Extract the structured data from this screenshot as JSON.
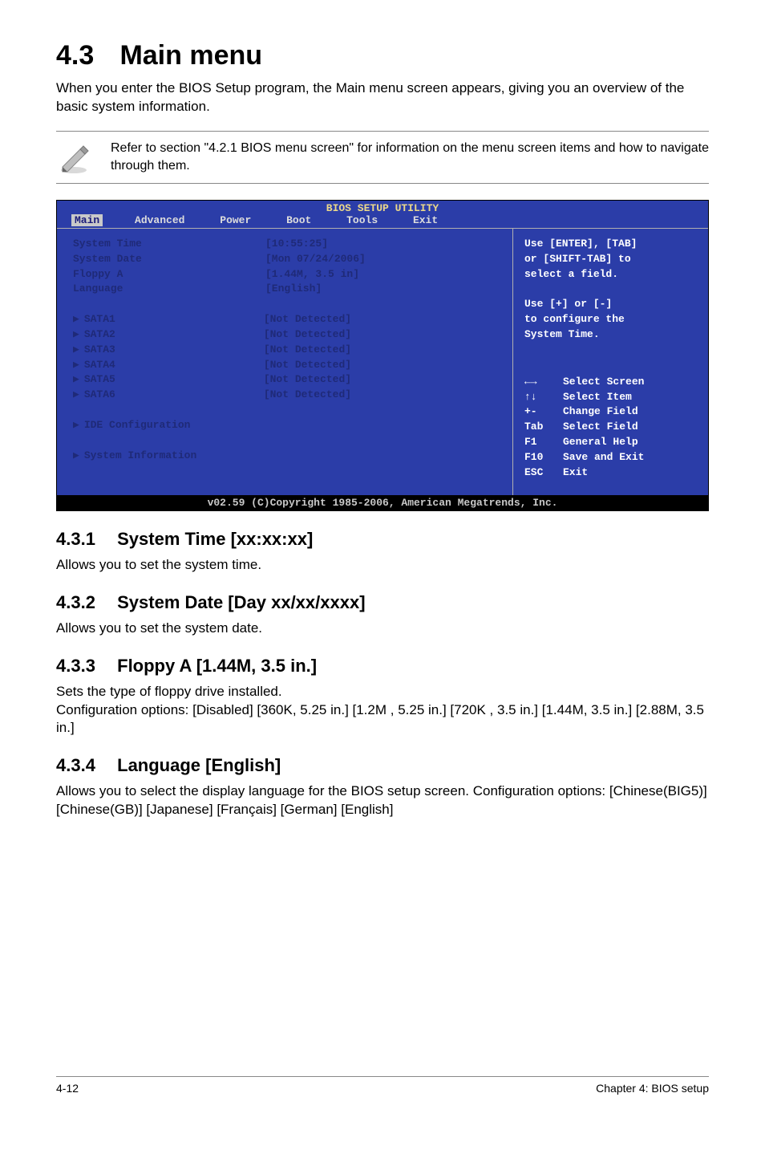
{
  "section": {
    "number": "4.3",
    "title": "Main menu",
    "intro": "When you enter the BIOS Setup program, the Main menu screen appears, giving you an overview of the basic system information."
  },
  "note": "Refer to section \"4.2.1  BIOS menu screen\" for information on the menu screen items and how to navigate through them.",
  "bios": {
    "header": "BIOS SETUP UTILITY",
    "tabs": [
      "Main",
      "Advanced",
      "Power",
      "Boot",
      "Tools",
      "Exit"
    ],
    "active_tab": "Main",
    "fields": [
      {
        "label": "System Time",
        "value": "[10:55:25]"
      },
      {
        "label": "System Date",
        "value": "[Mon 07/24/2006]"
      },
      {
        "label": "Floppy A",
        "value": "[1.44M, 3.5 in]"
      },
      {
        "label": "Language",
        "value": "[English]"
      }
    ],
    "sata": [
      {
        "label": "SATA1",
        "value": "[Not Detected]"
      },
      {
        "label": "SATA2",
        "value": "[Not Detected]"
      },
      {
        "label": "SATA3",
        "value": "[Not Detected]"
      },
      {
        "label": "SATA4",
        "value": "[Not Detected]"
      },
      {
        "label": "SATA5",
        "value": "[Not Detected]"
      },
      {
        "label": "SATA6",
        "value": "[Not Detected]"
      }
    ],
    "submenus": [
      "IDE Configuration",
      "System Information"
    ],
    "help_top": "Use [ENTER], [TAB]\nor [SHIFT-TAB] to\nselect a field.\n\nUse [+] or [-]\nto configure the\nSystem Time.",
    "legend": [
      {
        "key": "←→",
        "desc": "Select Screen"
      },
      {
        "key": "↑↓",
        "desc": "Select Item"
      },
      {
        "key": "+-",
        "desc": "Change Field"
      },
      {
        "key": "Tab",
        "desc": "Select Field"
      },
      {
        "key": "F1",
        "desc": "General Help"
      },
      {
        "key": "F10",
        "desc": "Save and Exit"
      },
      {
        "key": "ESC",
        "desc": "Exit"
      }
    ],
    "footer": "v02.59 (C)Copyright 1985-2006, American Megatrends, Inc."
  },
  "subsections": {
    "s1": {
      "num": "4.3.1",
      "title": "System Time [xx:xx:xx]",
      "body": "Allows you to set the system time."
    },
    "s2": {
      "num": "4.3.2",
      "title": "System Date [Day xx/xx/xxxx]",
      "body": "Allows you to set the system date."
    },
    "s3": {
      "num": "4.3.3",
      "title": "Floppy A [1.44M, 3.5 in.]",
      "body": "Sets the type of floppy drive installed.\nConfiguration options: [Disabled] [360K, 5.25 in.] [1.2M , 5.25 in.] [720K , 3.5 in.] [1.44M, 3.5 in.] [2.88M, 3.5 in.]"
    },
    "s4": {
      "num": "4.3.4",
      "title": "Language [English]",
      "body": "Allows you to select the display language for the BIOS setup screen. Configuration options: [Chinese(BIG5)] [Chinese(GB)] [Japanese] [Français] [German] [English]"
    }
  },
  "footer": {
    "left": "4-12",
    "right": "Chapter 4: BIOS setup"
  }
}
